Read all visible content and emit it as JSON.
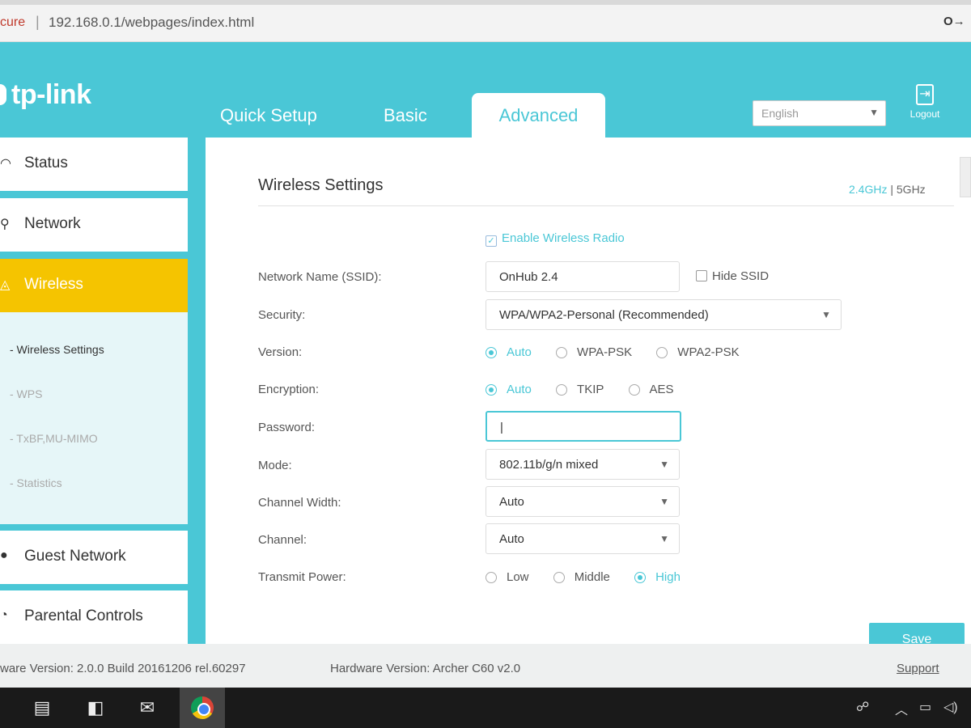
{
  "browser": {
    "secure_label": "cure",
    "separator": "|",
    "url": "192.168.0.1/webpages/index.html",
    "key_icon": "O→"
  },
  "header": {
    "logo_text": "tp-link",
    "tabs": [
      "Quick Setup",
      "Basic",
      "Advanced"
    ],
    "active_tab": "Advanced",
    "language": "English",
    "logout_label": "Logout"
  },
  "sidebar": {
    "items": [
      {
        "label": "Status",
        "icon": "gauge-icon"
      },
      {
        "label": "Network",
        "icon": "network-icon"
      },
      {
        "label": "Wireless",
        "icon": "wireless-icon"
      },
      {
        "label": "Guest Network",
        "icon": "guest-icon"
      },
      {
        "label": "Parental Controls",
        "icon": "parental-icon"
      }
    ],
    "submenu": [
      "- Wireless Settings",
      "- WPS",
      "- TxBF,MU-MIMO",
      "- Statistics"
    ]
  },
  "main": {
    "title": "Wireless Settings",
    "band_24": "2.4GHz",
    "band_sep": "|",
    "band_5": "5GHz",
    "enable_radio": "Enable Wireless Radio",
    "ssid_label": "Network Name (SSID):",
    "ssid_value": "OnHub 2.4",
    "hide_ssid": "Hide SSID",
    "security_label": "Security:",
    "security_value": "WPA/WPA2-Personal (Recommended)",
    "version_label": "Version:",
    "version_options": [
      "Auto",
      "WPA-PSK",
      "WPA2-PSK"
    ],
    "encryption_label": "Encryption:",
    "encryption_options": [
      "Auto",
      "TKIP",
      "AES"
    ],
    "password_label": "Password:",
    "password_value": "",
    "mode_label": "Mode:",
    "mode_value": "802.11b/g/n mixed",
    "width_label": "Channel Width:",
    "width_value": "Auto",
    "channel_label": "Channel:",
    "channel_value": "Auto",
    "power_label": "Transmit Power:",
    "power_options": [
      "Low",
      "Middle",
      "High"
    ],
    "save_label": "Save"
  },
  "footer": {
    "firmware": "ware Version: 2.0.0 Build 20161206 rel.60297",
    "hardware": "Hardware Version: Archer C60 v2.0",
    "support": "Support"
  },
  "colors": {
    "brand": "#4ac7d6",
    "wireless_active": "#f5c400"
  }
}
